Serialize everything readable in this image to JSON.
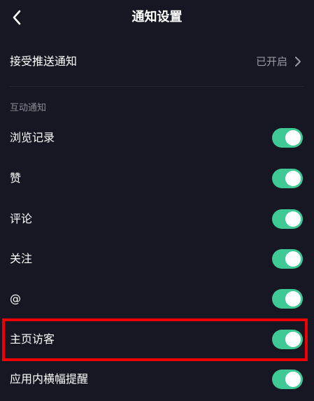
{
  "header": {
    "title": "通知设置",
    "back_icon": "chevron-left-icon"
  },
  "push": {
    "label": "接受推送通知",
    "status": "已开启",
    "chevron_icon": "chevron-right-icon"
  },
  "section": {
    "title": "互动通知"
  },
  "settings": [
    {
      "label": "浏览记录",
      "on": true
    },
    {
      "label": "赞",
      "on": true
    },
    {
      "label": "评论",
      "on": true
    },
    {
      "label": "关注",
      "on": true
    },
    {
      "label": "@",
      "on": true
    },
    {
      "label": "主页访客",
      "on": true
    },
    {
      "label": "应用内横幅提醒",
      "on": true
    }
  ],
  "colors": {
    "background": "#161722",
    "toggle_on": "#3ec995",
    "highlight": "#ee0000",
    "secondary_text": "#9a9ba3"
  }
}
